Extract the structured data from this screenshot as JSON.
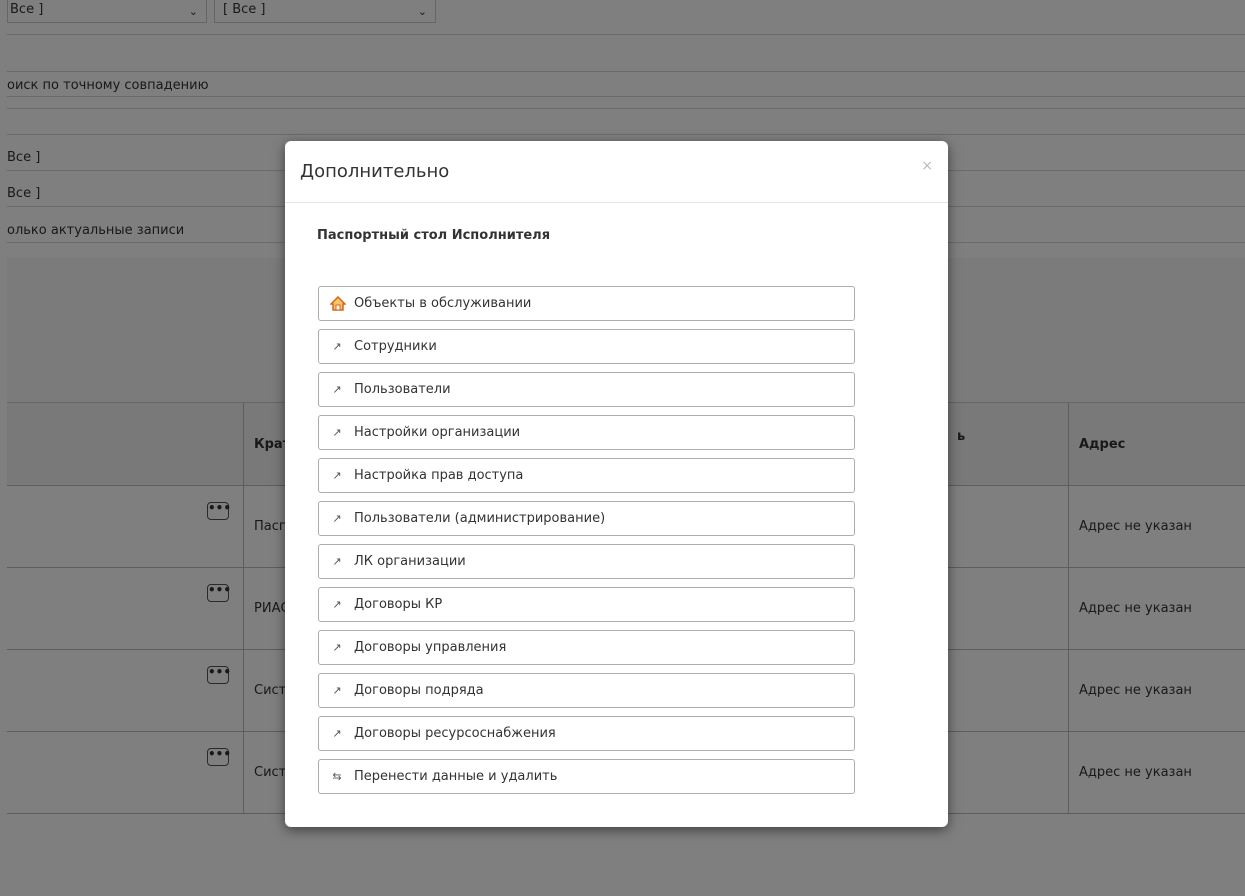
{
  "background": {
    "select_1": "Все ]",
    "select_2": "[ Все ]",
    "exact_match": "оиск по точному совпадению",
    "filter_all_1": "Все ]",
    "filter_all_2": "Все ]",
    "actual_only": "олько актуальные записи",
    "table": {
      "col_short": "Крат",
      "col_trunc": "ь",
      "col_address": "Адрес",
      "rows": [
        {
          "short": "Пасп",
          "address": "Адрес не указан"
        },
        {
          "short": "РИАС",
          "address": "Адрес не указан"
        },
        {
          "short": "Сист",
          "address": "Адрес не указан"
        },
        {
          "short": "Сист",
          "address": "Адрес не указан"
        }
      ],
      "dots_label": "•••"
    }
  },
  "modal": {
    "title": "Дополнительно",
    "close": "×",
    "section_title": "Паспортный стол Исполнителя",
    "items": [
      {
        "label": "Объекты в обслуживании",
        "icon": "home-icon"
      },
      {
        "label": "Сотрудники",
        "icon": "external-link-icon"
      },
      {
        "label": "Пользователи",
        "icon": "external-link-icon"
      },
      {
        "label": "Настройки организации",
        "icon": "external-link-icon"
      },
      {
        "label": "Настройка прав доступа",
        "icon": "external-link-icon"
      },
      {
        "label": "Пользователи (администрирование)",
        "icon": "external-link-icon"
      },
      {
        "label": "ЛК организации",
        "icon": "external-link-icon"
      },
      {
        "label": "Договоры КР",
        "icon": "external-link-icon"
      },
      {
        "label": "Договоры управления",
        "icon": "external-link-icon"
      },
      {
        "label": "Договоры подряда",
        "icon": "external-link-icon"
      },
      {
        "label": "Договоры ресурсоснабжения",
        "icon": "external-link-icon"
      },
      {
        "label": "Перенести данные и удалить",
        "icon": "transfer-icon"
      }
    ]
  },
  "colors": {
    "overlay": "#000000",
    "home_roof": "#e8741c"
  }
}
